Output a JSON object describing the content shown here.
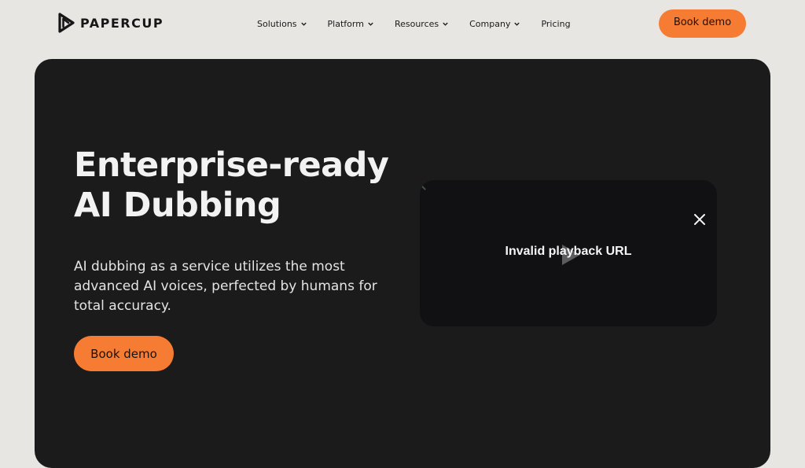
{
  "brand": {
    "name": "PAPERCUP",
    "accent_color": "#f77c33",
    "logo_icon": "papercup-logo-icon"
  },
  "nav": {
    "items": [
      {
        "label": "Solutions",
        "has_dropdown": true,
        "icon": "chevron-down-icon"
      },
      {
        "label": "Platform",
        "has_dropdown": true,
        "icon": "chevron-down-icon"
      },
      {
        "label": "Resources",
        "has_dropdown": true,
        "icon": "chevron-down-icon"
      },
      {
        "label": "Company",
        "has_dropdown": true,
        "icon": "chevron-down-icon"
      },
      {
        "label": "Pricing",
        "has_dropdown": false
      }
    ],
    "cta_label": "Book demo"
  },
  "hero": {
    "title_lines": [
      "Enterprise-ready",
      "AI Dubbing"
    ],
    "subtitle_lines": [
      "AI dubbing as a service utilizes the most",
      "advanced AI voices, perfected by humans for",
      "total accuracy."
    ],
    "cta_label": "Book demo",
    "background_color": "#1b1b1c"
  },
  "video": {
    "error_message": "Invalid playback URL",
    "close_icon": "close-icon",
    "play_icon": "play-icon"
  }
}
